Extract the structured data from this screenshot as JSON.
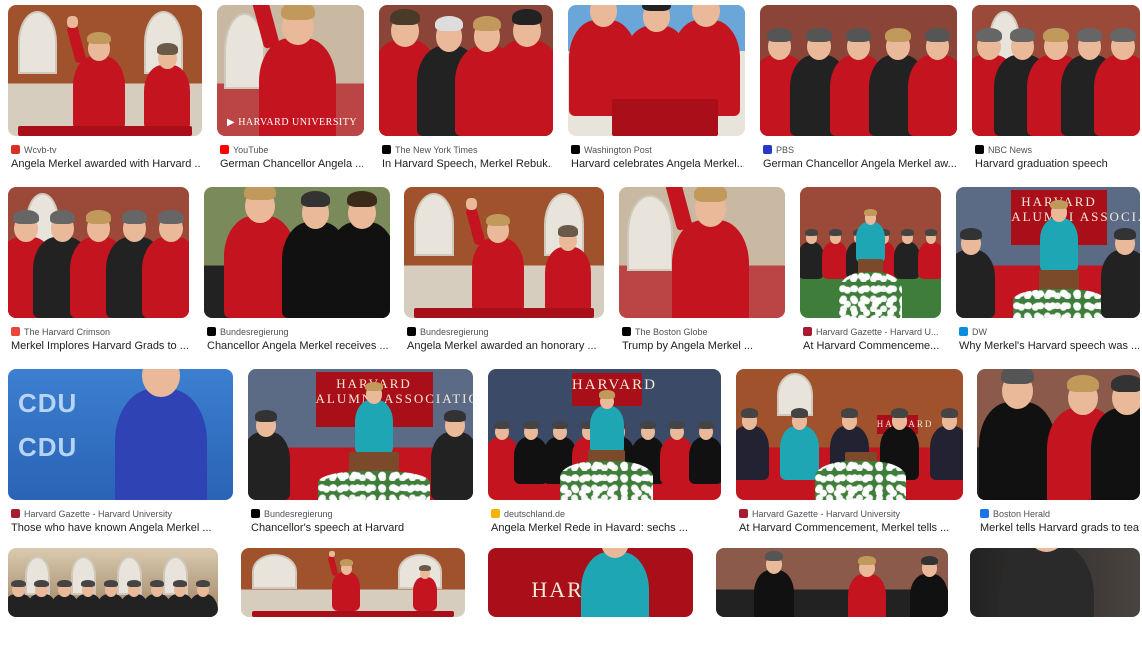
{
  "results": [
    {
      "source": "Wcvb-tv",
      "title": "Angela Merkel awarded with Harvard ...",
      "fav_icon": "wcvb-icon",
      "fav_color": "#d93025"
    },
    {
      "source": "YouTube",
      "title": "German Chancellor Angela ...",
      "fav_icon": "youtube-icon",
      "fav_color": "#ff0000",
      "overlay": "HARVARD UNIVERSITY"
    },
    {
      "source": "The New York Times",
      "title": "In Harvard Speech, Merkel Rebuk...",
      "fav_icon": "nytimes-icon",
      "fav_color": "#000000"
    },
    {
      "source": "Washington Post",
      "title": "Harvard celebrates Angela Merkel...",
      "fav_icon": "washington-post-icon",
      "fav_color": "#000000"
    },
    {
      "source": "PBS",
      "title": "German Chancellor Angela Merkel aw...",
      "fav_icon": "pbs-icon",
      "fav_color": "#2638c4"
    },
    {
      "source": "NBC News",
      "title": "Harvard graduation speech",
      "fav_icon": "nbc-icon",
      "fav_color": "#000000"
    },
    {
      "source": "The Harvard Crimson",
      "title": "Merkel Implores Harvard Grads to ...",
      "fav_icon": "harvard-crimson-icon",
      "fav_color": "#e8453c"
    },
    {
      "source": "Bundesregierung",
      "title": "Chancellor Angela Merkel receives ...",
      "fav_icon": "bundesregierung-icon",
      "fav_color": "#000000"
    },
    {
      "source": "Bundesregierung",
      "title": "Angela Merkel awarded an honorary ...",
      "fav_icon": "bundesregierung-icon",
      "fav_color": "#000000"
    },
    {
      "source": "The Boston Globe",
      "title": "Trump by Angela Merkel ...",
      "fav_icon": "boston-globe-icon",
      "fav_color": "#000000"
    },
    {
      "source": "Harvard Gazette - Harvard U...",
      "title": "At Harvard Commenceme...",
      "fav_icon": "harvard-gazette-icon",
      "fav_color": "#a51c30"
    },
    {
      "source": "DW",
      "title": "Why Merkel's Harvard speech was ...",
      "fav_icon": "dw-icon",
      "fav_color": "#0a8ddc"
    },
    {
      "source": "Harvard Gazette - Harvard University",
      "title": "Those who have known Angela Merkel ...",
      "fav_icon": "harvard-gazette-icon",
      "fav_color": "#a51c30",
      "overlay": "CDU\nCDU"
    },
    {
      "source": "Bundesregierung",
      "title": "Chancellor's speech at Harvard",
      "fav_icon": "bundesregierung-icon",
      "fav_color": "#000000",
      "overlay": "HARVARD\nALUMNI ASSOCIATION"
    },
    {
      "source": "deutschland.de",
      "title": "Angela Merkel Rede in Havard: sechs ...",
      "fav_icon": "deutschland-de-icon",
      "fav_color": "#f4b400",
      "overlay": "HARVARD"
    },
    {
      "source": "Harvard Gazette - Harvard University",
      "title": "At Harvard Commencement, Merkel tells ...",
      "fav_icon": "harvard-gazette-icon",
      "fav_color": "#a51c30",
      "overlay": "HARVARD"
    },
    {
      "source": "Boston Herald",
      "title": "Merkel tells Harvard grads to tear ...",
      "fav_icon": "boston-herald-icon",
      "fav_color": "#1a73e8"
    },
    {
      "source": "",
      "title": "",
      "fav_icon": "",
      "fav_color": ""
    },
    {
      "source": "",
      "title": "",
      "fav_icon": "",
      "fav_color": ""
    },
    {
      "source": "",
      "title": "",
      "fav_icon": "",
      "fav_color": "",
      "overlay": "HARVARD"
    },
    {
      "source": "",
      "title": "",
      "fav_icon": "",
      "fav_color": ""
    },
    {
      "source": "",
      "title": "",
      "fav_icon": "",
      "fav_color": ""
    }
  ],
  "row1_extra_overlay": "HARVARD\nALUMNI ASSOCIATION"
}
